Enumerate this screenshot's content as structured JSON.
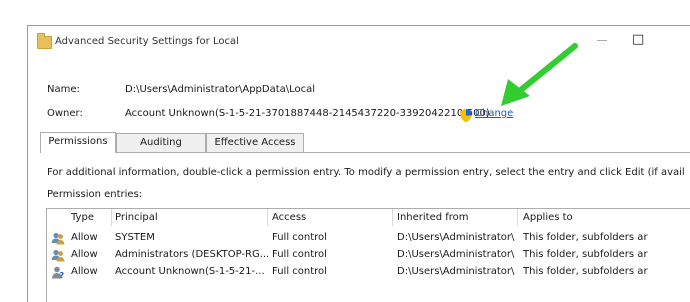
{
  "window": {
    "title": "Advanced Security Settings for Local"
  },
  "details": {
    "name_label": "Name:",
    "name_value": "D:\\Users\\Administrator\\AppData\\Local",
    "owner_label": "Owner:",
    "owner_value": "Account Unknown(S-1-5-21-3701887448-2145437220-3392042210-500)",
    "change_label": "Change"
  },
  "tabs": [
    {
      "label": "Permissions",
      "active": true
    },
    {
      "label": "Auditing",
      "active": false
    },
    {
      "label": "Effective Access",
      "active": false
    }
  ],
  "info_text": "For additional information, double-click a permission entry. To modify a permission entry, select the entry and click Edit (if avail",
  "entries_label": "Permission entries:",
  "table": {
    "headers": [
      "Type",
      "Principal",
      "Access",
      "Inherited from",
      "Applies to"
    ],
    "rows": [
      {
        "type": "Allow",
        "principal": "SYSTEM",
        "access": "Full control",
        "inherited": "D:\\Users\\Administrator\\",
        "applies": "This folder, subfolders ar"
      },
      {
        "type": "Allow",
        "principal": "Administrators (DESKTOP-RG...",
        "access": "Full control",
        "inherited": "D:\\Users\\Administrator\\",
        "applies": "This folder, subfolders ar"
      },
      {
        "type": "Allow",
        "principal": "Account Unknown(S-1-5-21-...",
        "access": "Full control",
        "inherited": "D:\\Users\\Administrator\\",
        "applies": "This folder, subfolders ar"
      }
    ]
  },
  "colors": {
    "link": "#1a5fb4",
    "arrow": "#33cc33",
    "folder": "#e8c05a"
  },
  "icons": [
    "folder-icon",
    "uac-shield-icon",
    "users-icon",
    "unknown-user-icon",
    "green-arrow-annotation"
  ]
}
